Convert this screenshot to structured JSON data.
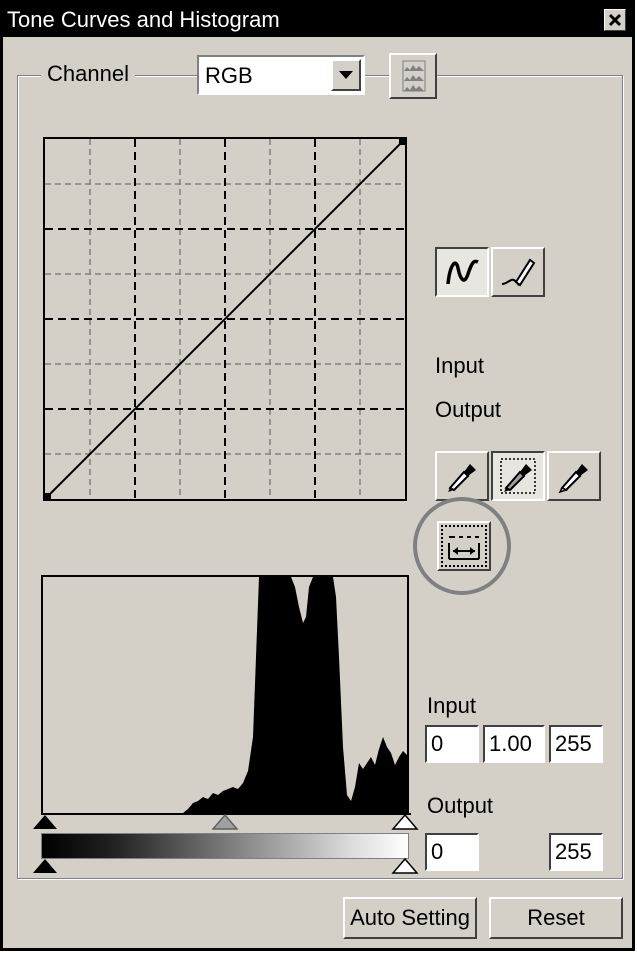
{
  "window": {
    "title": "Tone Curves and Histogram",
    "close_glyph": "✕"
  },
  "channel": {
    "label": "Channel",
    "selected": "RGB",
    "dropdown_arrow": "▼"
  },
  "curve": {
    "input_label": "Input",
    "output_label": "Output"
  },
  "levels": {
    "input_label": "Input",
    "input_black": "0",
    "input_gamma": "1.00",
    "input_white": "255",
    "output_label": "Output",
    "output_black": "0",
    "output_white": "255"
  },
  "buttons": {
    "auto_setting": "Auto Setting",
    "reset": "Reset"
  },
  "icons": {
    "histogram": "histogram-icon",
    "curve_tool": "curve-tool-icon",
    "freehand_tool": "pencil-icon",
    "black_eyedropper": "eyedropper-icon",
    "gray_eyedropper": "eyedropper-icon",
    "white_eyedropper": "eyedropper-icon",
    "auto_levels": "auto-levels-icon"
  },
  "colors": {
    "window_bg": "#d4d0c8",
    "titlebar_bg": "#000000",
    "highlight_circle": "#808080"
  }
}
